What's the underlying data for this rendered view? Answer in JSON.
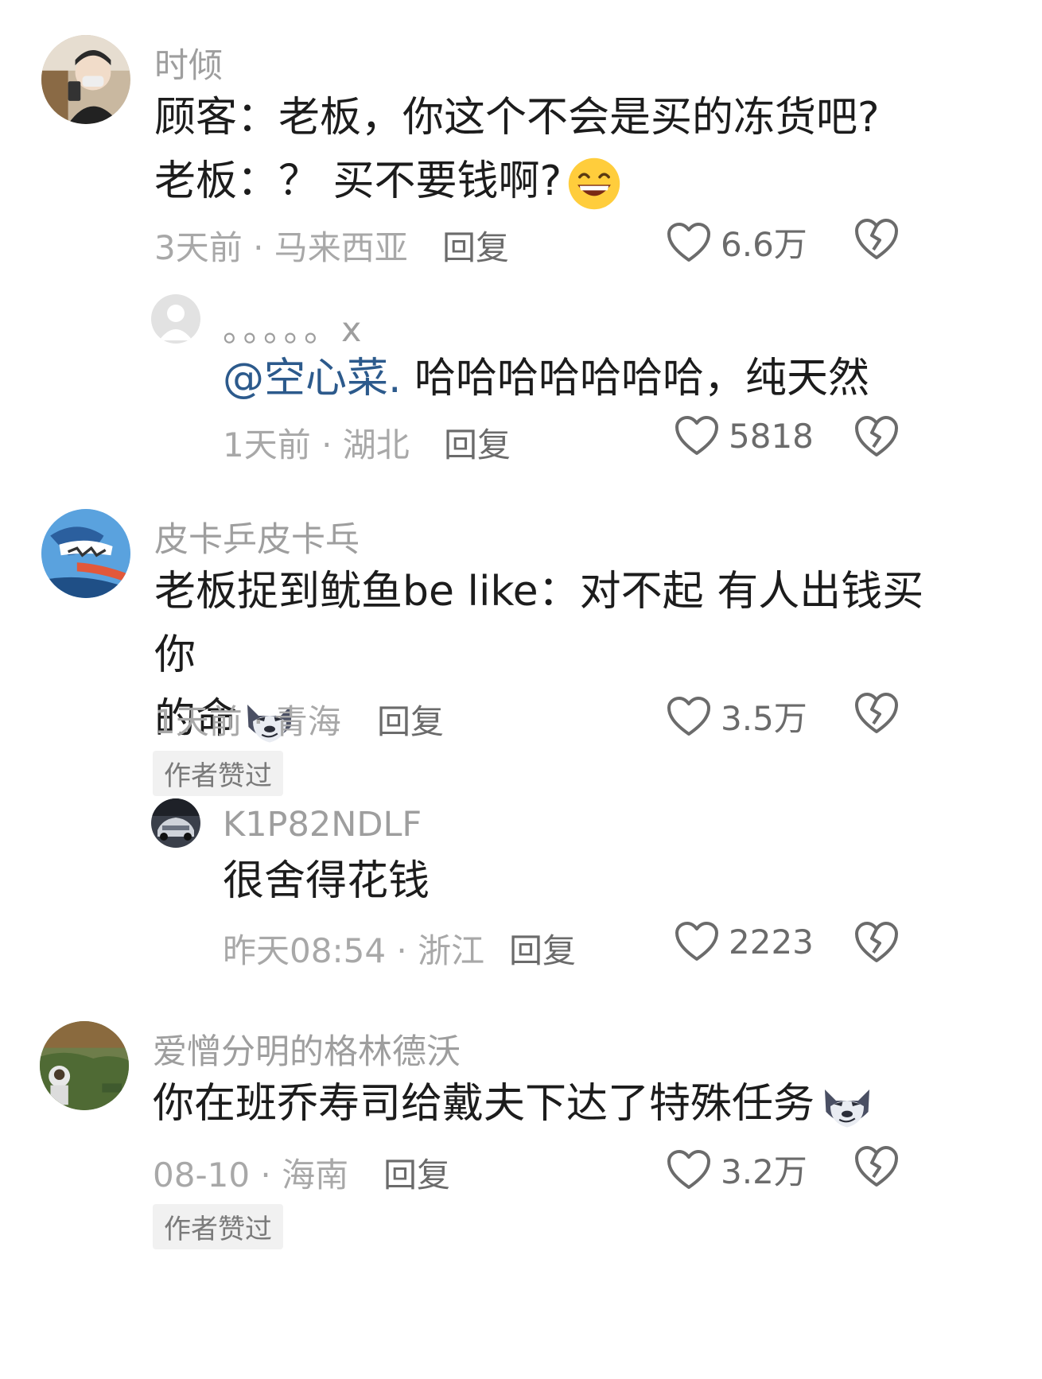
{
  "comments": [
    {
      "username": "时倾",
      "text_line1": "顾客：老板，你这个不会是买的冻货吧?",
      "text_line2": "老板：？ 买不要钱啊?",
      "time_location": "3天前 · 马来西亚",
      "reply_label": "回复",
      "likes": "6.6万",
      "replies": [
        {
          "username": "。。。。。x",
          "mention": "@空心菜.",
          "text": " 哈哈哈哈哈哈哈，纯天然",
          "time_location": "1天前 · 湖北",
          "reply_label": "回复",
          "likes": "5818"
        }
      ]
    },
    {
      "username": "皮卡乒皮卡乓",
      "text_line1": "老板捉到鱿鱼be like：对不起 有人出钱买你",
      "text_line2": "的命",
      "time_location": "1天前 · 青海",
      "reply_label": "回复",
      "likes": "3.5万",
      "badge": "作者赞过",
      "replies": [
        {
          "username": "K1P82NDLF",
          "text": "很舍得花钱",
          "time_location": "昨天08:54 · 浙江",
          "reply_label": "回复",
          "likes": "2223"
        }
      ]
    },
    {
      "username": "爱憎分明的格林德沃",
      "text_line1": "你在班乔寿司给戴夫下达了特殊任务",
      "time_location": "08-10 · 海南",
      "reply_label": "回复",
      "likes": "3.2万",
      "badge": "作者赞过"
    }
  ],
  "icons": {
    "like": "heart-outline-icon",
    "dislike": "broken-heart-icon",
    "emoji_grin": "grinning-face-emoji",
    "emoji_wolf": "wolf-face-emoji"
  },
  "colors": {
    "mention": "#2c5a8c",
    "muted_text": "#a8a8a8",
    "username": "#9e9e9e",
    "badge_bg": "#f1f1f1"
  }
}
